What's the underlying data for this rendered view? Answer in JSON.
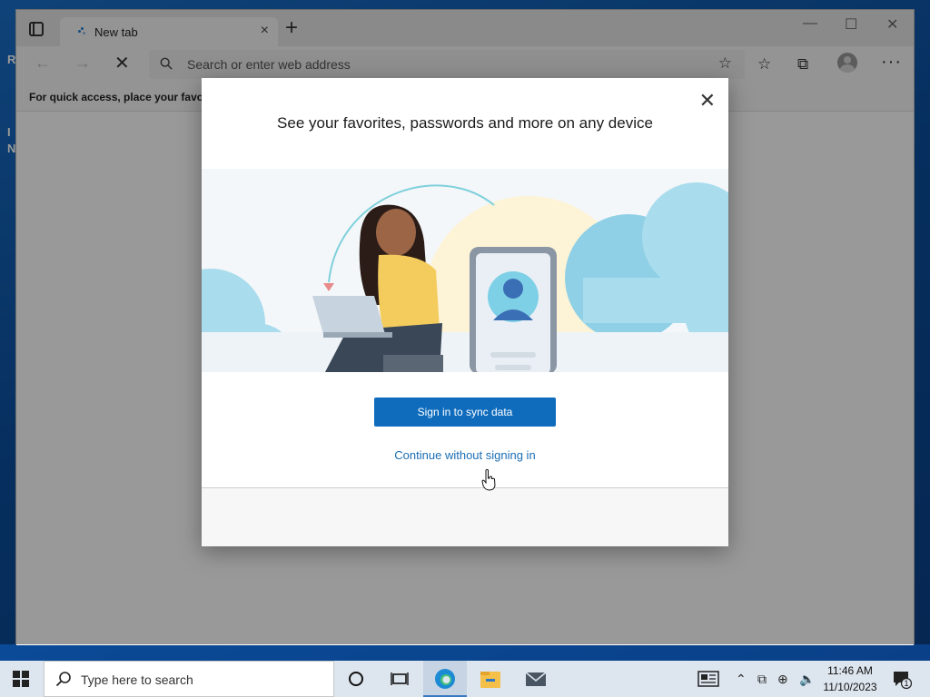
{
  "desktop": {
    "edge_letters": [
      "R",
      "I",
      "N"
    ]
  },
  "browser": {
    "tab": {
      "title": "New tab",
      "close": "×"
    },
    "new_tab": "+",
    "window_controls": {
      "minimize": "—",
      "maximize": "☐",
      "close": "✕"
    },
    "toolbar": {
      "back": "←",
      "forward": "→",
      "stop": "✕",
      "address_placeholder": "Search or enter web address",
      "more": "···"
    },
    "favorites_bar_text": "For quick access, place your favorit"
  },
  "dialog": {
    "close": "✕",
    "title": "See your favorites, passwords and more on any device",
    "primary_button": "Sign in to sync data",
    "secondary_link": "Continue without signing in"
  },
  "taskbar": {
    "search_placeholder": "Type here to search",
    "time": "11:46 AM",
    "date": "11/10/2023",
    "notification_count": "1"
  },
  "colors": {
    "accent": "#0f6cbd",
    "link": "#1a6db3",
    "desktop_blue": "#0b4f9e",
    "taskbar": "#dde5ee"
  }
}
